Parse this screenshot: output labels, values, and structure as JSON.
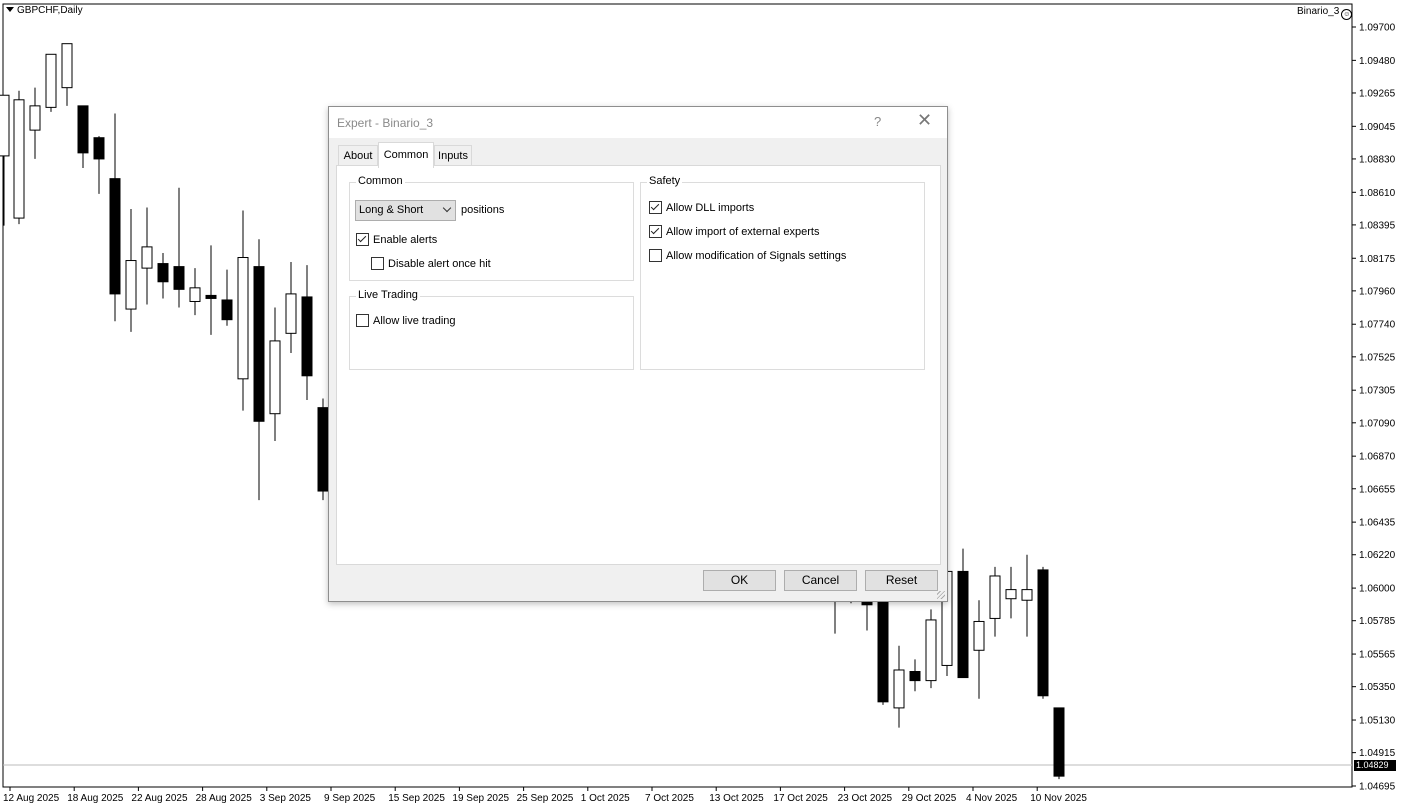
{
  "chart": {
    "symbol": "GBPCHF,Daily",
    "expert_label": "Binario_3",
    "current_price": "1.04829",
    "price_labels": [
      "1.09700",
      "1.09480",
      "1.09265",
      "1.09045",
      "1.08830",
      "1.08610",
      "1.08395",
      "1.08175",
      "1.07960",
      "1.07740",
      "1.07525",
      "1.07305",
      "1.07090",
      "1.06870",
      "1.06655",
      "1.06435",
      "1.06220",
      "1.06000",
      "1.05785",
      "1.05565",
      "1.05350",
      "1.05130",
      "1.04915",
      "1.04695"
    ],
    "date_labels": [
      "12 Aug 2025",
      "18 Aug 2025",
      "22 Aug 2025",
      "28 Aug 2025",
      "3 Sep 2025",
      "9 Sep 2025",
      "15 Sep 2025",
      "19 Sep 2025",
      "25 Sep 2025",
      "1 Oct 2025",
      "7 Oct 2025",
      "13 Oct 2025",
      "17 Oct 2025",
      "23 Oct 2025",
      "29 Oct 2025",
      "4 Nov 2025",
      "10 Nov 2025"
    ],
    "candles": [
      [
        1.0885,
        1.0925,
        1.0897,
        1.0839
      ],
      [
        1.0844,
        1.0922,
        1.084,
        1.0928
      ],
      [
        1.0902,
        1.0918,
        1.0883,
        1.093
      ],
      [
        1.0917,
        1.0952,
        1.0914,
        1.0944
      ],
      [
        1.093,
        1.0959,
        1.0918,
        1.0939
      ],
      [
        1.0918,
        1.0887,
        1.0911,
        1.0877
      ],
      [
        1.0897,
        1.0883,
        1.0898,
        1.086
      ],
      [
        1.087,
        1.0794,
        1.0913,
        1.0776
      ],
      [
        1.0784,
        1.0816,
        1.0769,
        1.085
      ],
      [
        1.0811,
        1.0825,
        1.0787,
        1.0851
      ],
      [
        1.0814,
        1.0802,
        1.0821,
        1.0791
      ],
      [
        1.0812,
        1.0797,
        1.0864,
        1.0785
      ],
      [
        1.0789,
        1.0798,
        1.0811,
        1.078
      ],
      [
        1.0793,
        1.0791,
        1.0826,
        1.0767
      ],
      [
        1.079,
        1.0777,
        1.081,
        1.0773
      ],
      [
        1.0738,
        1.0818,
        1.0717,
        1.0849
      ],
      [
        1.0812,
        1.071,
        1.083,
        1.0658
      ],
      [
        1.0715,
        1.0763,
        1.0697,
        1.0785
      ],
      [
        1.0768,
        1.0794,
        1.0755,
        1.0815
      ],
      [
        1.0792,
        1.074,
        1.0813,
        1.0724
      ],
      [
        1.0719,
        1.0664,
        1.0725,
        1.0658
      ],
      [
        1.0669,
        1.0722,
        1.0656,
        1.0736
      ],
      [
        1.0596,
        1.0596,
        1.06,
        1.057
      ],
      [
        1.0592,
        1.0595,
        1.0598,
        1.059
      ],
      [
        1.0593,
        1.0589,
        1.0604,
        1.0572
      ],
      [
        1.0598,
        1.0597,
        1.0605,
        1.059
      ],
      [
        1.0606,
        1.0525,
        1.0613,
        1.0523
      ],
      [
        1.0521,
        1.0546,
        1.0508,
        1.0562
      ],
      [
        1.0545,
        1.0539,
        1.0553,
        1.0532
      ],
      [
        1.0539,
        1.0579,
        1.0534,
        1.0586
      ],
      [
        1.0549,
        1.0611,
        1.0542,
        1.0618
      ],
      [
        1.0611,
        1.0541,
        1.0626,
        1.0541
      ],
      [
        1.0559,
        1.0578,
        1.0527,
        1.0592
      ],
      [
        1.058,
        1.0608,
        1.0568,
        1.0614
      ],
      [
        1.0593,
        1.0599,
        1.058,
        1.0614
      ],
      [
        1.0592,
        1.0599,
        1.0568,
        1.0622
      ],
      [
        1.0612,
        1.0529,
        1.0614,
        1.0527
      ],
      [
        1.0521,
        1.0476,
        1.0498,
        1.0474
      ]
    ]
  },
  "dialog": {
    "title": "Expert - Binario_3",
    "help_glyph": "?",
    "close_glyph": "✕",
    "tabs": [
      "About",
      "Common",
      "Inputs"
    ],
    "common_group": "Common",
    "direction_value": "Long & Short",
    "positions_label": "positions",
    "enable_alerts": "Enable alerts",
    "disable_alert_once_hit": "Disable alert once hit",
    "live_group": "Live Trading",
    "allow_live_trading": "Allow live trading",
    "safety_group": "Safety",
    "allow_dll_imports": "Allow DLL imports",
    "allow_import_external": "Allow import of external experts",
    "allow_modification_signals": "Allow modification of Signals settings",
    "ok": "OK",
    "cancel": "Cancel",
    "reset": "Reset"
  }
}
